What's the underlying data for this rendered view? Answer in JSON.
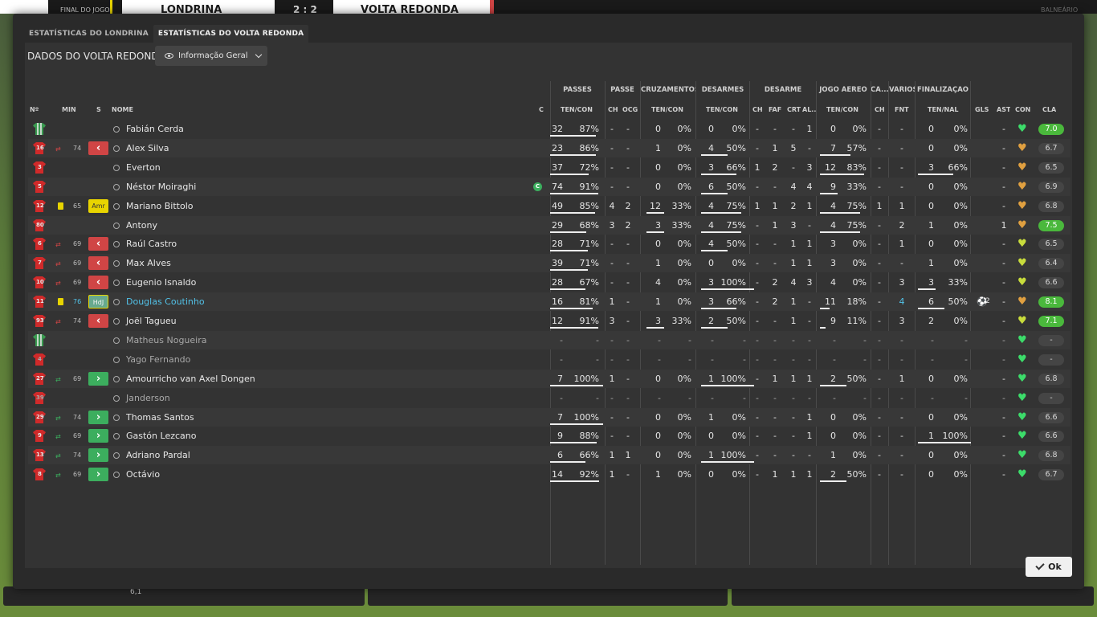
{
  "topbar": {
    "status": "FINAL DO JOGO",
    "home_team": "LONDRINA",
    "score": "2 : 2",
    "away_team": "VOLTA REDONDA",
    "right_label": "BALNEÁRIO"
  },
  "tabs": [
    {
      "label": "ESTATÍSTICAS DO LONDRINA",
      "active": false
    },
    {
      "label": "ESTATÍSTICAS DO VOLTA REDONDA",
      "active": true
    }
  ],
  "content_title": "DADOS DO VOLTA REDONDA",
  "view_dropdown": "Informação Geral",
  "column_groups": [
    "PASSES",
    "PASSE",
    "CRUZAMENTOS",
    "DESARMES",
    "DESARME",
    "JOGO AÉREO",
    "CA...",
    "VÁRIOS",
    "FINALIZAÇÃO"
  ],
  "columns": {
    "num": "Nº",
    "min": "MIN",
    "s": "S",
    "name": "NOME",
    "c": "C",
    "passes": "TEN/CON",
    "passe_ch": "CH",
    "passe_ocg": "OCG",
    "cruz": "TEN/CON",
    "des": "TEN/CON",
    "desarme_ch": "CH",
    "desarme_faf": "FAF",
    "desarme_crt": "CRT",
    "desarme_al": "AL...",
    "aereo": "TEN/CON",
    "ca_ch": "CH",
    "varios_fnt": "FNT",
    "final": "TEN/NAL",
    "gls": "GLS",
    "ast": "AST",
    "con": "CON",
    "cla": "CLA"
  },
  "players": [
    {
      "num": "",
      "shirt": "gk",
      "min": "",
      "sub": "",
      "card": false,
      "status": "",
      "name": "Fabián Cerda",
      "captain": false,
      "pass_t": "32",
      "pass_p": "87%",
      "p_ch": "-",
      "p_ocg": "-",
      "cr_t": "0",
      "cr_p": "0%",
      "de_t": "0",
      "de_p": "0%",
      "d_ch": "-",
      "d_faf": "-",
      "d_crt": "-",
      "d_al": "1",
      "a_t": "0",
      "a_p": "0%",
      "ca_ch": "-",
      "fnt": "-",
      "f_t": "0",
      "f_p": "0%",
      "gls": "",
      "ast": "-",
      "con_color": "#3cdc6a",
      "cla": "7.0",
      "cla_hi": true,
      "highlight": false
    },
    {
      "num": "16",
      "shirt": "red",
      "min": "74",
      "sub": "out",
      "card": false,
      "status": "out",
      "name": "Alex Silva",
      "captain": false,
      "pass_t": "23",
      "pass_p": "86%",
      "p_ch": "-",
      "p_ocg": "-",
      "cr_t": "1",
      "cr_p": "0%",
      "de_t": "4",
      "de_p": "50%",
      "d_ch": "-",
      "d_faf": "1",
      "d_crt": "5",
      "d_al": "-",
      "a_t": "7",
      "a_p": "57%",
      "ca_ch": "-",
      "fnt": "-",
      "f_t": "0",
      "f_p": "0%",
      "gls": "",
      "ast": "-",
      "con_color": "#e0a040",
      "cla": "6.7",
      "cla_hi": false,
      "highlight": false
    },
    {
      "num": "3",
      "shirt": "red",
      "min": "",
      "sub": "",
      "card": false,
      "status": "",
      "name": "Everton",
      "captain": false,
      "pass_t": "37",
      "pass_p": "72%",
      "p_ch": "-",
      "p_ocg": "-",
      "cr_t": "0",
      "cr_p": "0%",
      "de_t": "3",
      "de_p": "66%",
      "d_ch": "1",
      "d_faf": "2",
      "d_crt": "-",
      "d_al": "3",
      "a_t": "12",
      "a_p": "83%",
      "ca_ch": "-",
      "fnt": "-",
      "f_t": "3",
      "f_p": "66%",
      "gls": "",
      "ast": "-",
      "con_color": "#e0a040",
      "cla": "6.5",
      "cla_hi": false,
      "highlight": false
    },
    {
      "num": "5",
      "shirt": "red",
      "min": "",
      "sub": "",
      "card": false,
      "status": "",
      "name": "Néstor Moiraghi",
      "captain": true,
      "pass_t": "74",
      "pass_p": "91%",
      "p_ch": "-",
      "p_ocg": "-",
      "cr_t": "0",
      "cr_p": "0%",
      "de_t": "6",
      "de_p": "50%",
      "d_ch": "-",
      "d_faf": "-",
      "d_crt": "4",
      "d_al": "4",
      "a_t": "9",
      "a_p": "33%",
      "ca_ch": "-",
      "fnt": "-",
      "f_t": "0",
      "f_p": "0%",
      "gls": "",
      "ast": "-",
      "con_color": "#e0a040",
      "cla": "6.9",
      "cla_hi": false,
      "highlight": false
    },
    {
      "num": "12",
      "shirt": "red",
      "min": "65",
      "sub": "",
      "card": true,
      "status": "amr",
      "name": "Mariano Bittolo",
      "captain": false,
      "pass_t": "49",
      "pass_p": "85%",
      "p_ch": "4",
      "p_ocg": "2",
      "cr_t": "12",
      "cr_p": "33%",
      "de_t": "4",
      "de_p": "75%",
      "d_ch": "1",
      "d_faf": "1",
      "d_crt": "2",
      "d_al": "1",
      "a_t": "4",
      "a_p": "75%",
      "ca_ch": "1",
      "fnt": "1",
      "f_t": "0",
      "f_p": "0%",
      "gls": "",
      "ast": "-",
      "con_color": "#e0a040",
      "cla": "6.8",
      "cla_hi": false,
      "highlight": false
    },
    {
      "num": "80",
      "shirt": "red",
      "min": "",
      "sub": "",
      "card": false,
      "status": "",
      "name": "Antony",
      "captain": false,
      "pass_t": "29",
      "pass_p": "68%",
      "p_ch": "3",
      "p_ocg": "2",
      "cr_t": "3",
      "cr_p": "33%",
      "de_t": "4",
      "de_p": "75%",
      "d_ch": "-",
      "d_faf": "1",
      "d_crt": "3",
      "d_al": "-",
      "a_t": "4",
      "a_p": "75%",
      "ca_ch": "-",
      "fnt": "2",
      "f_t": "1",
      "f_p": "0%",
      "gls": "",
      "ast": "1",
      "con_color": "#e0a040",
      "cla": "7.5",
      "cla_hi": true,
      "highlight": false
    },
    {
      "num": "6",
      "shirt": "red",
      "min": "69",
      "sub": "out",
      "card": false,
      "status": "out",
      "name": "Raúl Castro",
      "captain": false,
      "pass_t": "28",
      "pass_p": "71%",
      "p_ch": "-",
      "p_ocg": "-",
      "cr_t": "0",
      "cr_p": "0%",
      "de_t": "4",
      "de_p": "50%",
      "d_ch": "-",
      "d_faf": "-",
      "d_crt": "1",
      "d_al": "1",
      "a_t": "3",
      "a_p": "0%",
      "ca_ch": "-",
      "fnt": "1",
      "f_t": "0",
      "f_p": "0%",
      "gls": "",
      "ast": "-",
      "con_color": "#c8dc3c",
      "cla": "6.5",
      "cla_hi": false,
      "highlight": false
    },
    {
      "num": "7",
      "shirt": "red",
      "min": "69",
      "sub": "out",
      "card": false,
      "status": "out",
      "name": "Max Alves",
      "captain": false,
      "pass_t": "39",
      "pass_p": "71%",
      "p_ch": "-",
      "p_ocg": "-",
      "cr_t": "1",
      "cr_p": "0%",
      "de_t": "0",
      "de_p": "0%",
      "d_ch": "-",
      "d_faf": "-",
      "d_crt": "1",
      "d_al": "1",
      "a_t": "3",
      "a_p": "0%",
      "ca_ch": "-",
      "fnt": "-",
      "f_t": "1",
      "f_p": "0%",
      "gls": "",
      "ast": "-",
      "con_color": "#c8dc3c",
      "cla": "6.4",
      "cla_hi": false,
      "highlight": false
    },
    {
      "num": "10",
      "shirt": "red",
      "min": "69",
      "sub": "out",
      "card": false,
      "status": "out",
      "name": "Eugenio Isnaldo",
      "captain": false,
      "pass_t": "28",
      "pass_p": "67%",
      "p_ch": "-",
      "p_ocg": "-",
      "cr_t": "4",
      "cr_p": "0%",
      "de_t": "3",
      "de_p": "100%",
      "d_ch": "-",
      "d_faf": "2",
      "d_crt": "4",
      "d_al": "3",
      "a_t": "4",
      "a_p": "0%",
      "ca_ch": "-",
      "fnt": "3",
      "f_t": "3",
      "f_p": "33%",
      "gls": "",
      "ast": "-",
      "con_color": "#c8dc3c",
      "cla": "6.6",
      "cla_hi": false,
      "highlight": false
    },
    {
      "num": "11",
      "shirt": "red",
      "min": "76",
      "sub": "",
      "card": true,
      "status": "hdj",
      "name": "Douglas Coutinho",
      "captain": false,
      "pass_t": "16",
      "pass_p": "81%",
      "p_ch": "1",
      "p_ocg": "-",
      "cr_t": "1",
      "cr_p": "0%",
      "de_t": "3",
      "de_p": "66%",
      "d_ch": "-",
      "d_faf": "2",
      "d_crt": "1",
      "d_al": "-",
      "a_t": "11",
      "a_p": "18%",
      "ca_ch": "-",
      "fnt": "4",
      "f_t": "6",
      "f_p": "50%",
      "gls": "2",
      "ast": "-",
      "con_color": "#e0a040",
      "cla": "8.1",
      "cla_hi": true,
      "highlight": true
    },
    {
      "num": "93",
      "shirt": "red",
      "min": "74",
      "sub": "out",
      "card": false,
      "status": "out",
      "name": "Joël Tagueu",
      "captain": false,
      "pass_t": "12",
      "pass_p": "91%",
      "p_ch": "3",
      "p_ocg": "-",
      "cr_t": "3",
      "cr_p": "33%",
      "de_t": "2",
      "de_p": "50%",
      "d_ch": "-",
      "d_faf": "-",
      "d_crt": "1",
      "d_al": "-",
      "a_t": "9",
      "a_p": "11%",
      "ca_ch": "-",
      "fnt": "3",
      "f_t": "2",
      "f_p": "0%",
      "gls": "",
      "ast": "-",
      "con_color": "#c8dc3c",
      "cla": "7.1",
      "cla_hi": true,
      "highlight": false
    },
    {
      "num": "",
      "shirt": "gk",
      "min": "",
      "sub": "",
      "card": false,
      "status": "",
      "name": "Matheus Nogueira",
      "captain": false,
      "pass_t": "-",
      "pass_p": "-",
      "p_ch": "-",
      "p_ocg": "-",
      "cr_t": "-",
      "cr_p": "-",
      "de_t": "-",
      "de_p": "-",
      "d_ch": "-",
      "d_faf": "-",
      "d_crt": "-",
      "d_al": "-",
      "a_t": "-",
      "a_p": "-",
      "ca_ch": "-",
      "fnt": "-",
      "f_t": "-",
      "f_p": "-",
      "gls": "",
      "ast": "-",
      "con_color": "#3cdc6a",
      "cla": "-",
      "cla_hi": false,
      "highlight": false,
      "dim": true
    },
    {
      "num": "4",
      "shirt": "red",
      "min": "",
      "sub": "",
      "card": false,
      "status": "",
      "name": "Yago Fernando",
      "captain": false,
      "pass_t": "-",
      "pass_p": "-",
      "p_ch": "-",
      "p_ocg": "-",
      "cr_t": "-",
      "cr_p": "-",
      "de_t": "-",
      "de_p": "-",
      "d_ch": "-",
      "d_faf": "-",
      "d_crt": "-",
      "d_al": "-",
      "a_t": "-",
      "a_p": "-",
      "ca_ch": "-",
      "fnt": "-",
      "f_t": "-",
      "f_p": "-",
      "gls": "",
      "ast": "-",
      "con_color": "#3cdc6a",
      "cla": "-",
      "cla_hi": false,
      "highlight": false,
      "dim": true
    },
    {
      "num": "27",
      "shirt": "red",
      "min": "69",
      "sub": "in",
      "card": false,
      "status": "in",
      "name": "Amourricho van Axel Dongen",
      "captain": false,
      "pass_t": "7",
      "pass_p": "100%",
      "p_ch": "1",
      "p_ocg": "-",
      "cr_t": "0",
      "cr_p": "0%",
      "de_t": "1",
      "de_p": "100%",
      "d_ch": "-",
      "d_faf": "1",
      "d_crt": "1",
      "d_al": "1",
      "a_t": "2",
      "a_p": "50%",
      "ca_ch": "-",
      "fnt": "1",
      "f_t": "0",
      "f_p": "0%",
      "gls": "",
      "ast": "-",
      "con_color": "#3cdc6a",
      "cla": "6.8",
      "cla_hi": false,
      "highlight": false
    },
    {
      "num": "39",
      "shirt": "red",
      "min": "",
      "sub": "",
      "card": false,
      "status": "",
      "name": "Janderson",
      "captain": false,
      "pass_t": "-",
      "pass_p": "-",
      "p_ch": "-",
      "p_ocg": "-",
      "cr_t": "-",
      "cr_p": "-",
      "de_t": "-",
      "de_p": "-",
      "d_ch": "-",
      "d_faf": "-",
      "d_crt": "-",
      "d_al": "-",
      "a_t": "-",
      "a_p": "-",
      "ca_ch": "-",
      "fnt": "-",
      "f_t": "-",
      "f_p": "-",
      "gls": "",
      "ast": "-",
      "con_color": "#3cdc6a",
      "cla": "-",
      "cla_hi": false,
      "highlight": false,
      "dim": true
    },
    {
      "num": "29",
      "shirt": "red",
      "min": "74",
      "sub": "in",
      "card": false,
      "status": "in",
      "name": "Thomas Santos",
      "captain": false,
      "pass_t": "7",
      "pass_p": "100%",
      "p_ch": "-",
      "p_ocg": "-",
      "cr_t": "0",
      "cr_p": "0%",
      "de_t": "1",
      "de_p": "0%",
      "d_ch": "-",
      "d_faf": "-",
      "d_crt": "-",
      "d_al": "1",
      "a_t": "0",
      "a_p": "0%",
      "ca_ch": "-",
      "fnt": "-",
      "f_t": "0",
      "f_p": "0%",
      "gls": "",
      "ast": "-",
      "con_color": "#3cdc6a",
      "cla": "6.6",
      "cla_hi": false,
      "highlight": false
    },
    {
      "num": "9",
      "shirt": "red",
      "min": "69",
      "sub": "in",
      "card": false,
      "status": "in",
      "name": "Gastón Lezcano",
      "captain": false,
      "pass_t": "9",
      "pass_p": "88%",
      "p_ch": "-",
      "p_ocg": "-",
      "cr_t": "0",
      "cr_p": "0%",
      "de_t": "0",
      "de_p": "0%",
      "d_ch": "-",
      "d_faf": "-",
      "d_crt": "-",
      "d_al": "1",
      "a_t": "0",
      "a_p": "0%",
      "ca_ch": "-",
      "fnt": "-",
      "f_t": "1",
      "f_p": "100%",
      "gls": "",
      "ast": "-",
      "con_color": "#3cdc6a",
      "cla": "6.6",
      "cla_hi": false,
      "highlight": false
    },
    {
      "num": "13",
      "shirt": "red",
      "min": "74",
      "sub": "in",
      "card": false,
      "status": "in",
      "name": "Adriano Pardal",
      "captain": false,
      "pass_t": "6",
      "pass_p": "66%",
      "p_ch": "1",
      "p_ocg": "1",
      "cr_t": "0",
      "cr_p": "0%",
      "de_t": "1",
      "de_p": "100%",
      "d_ch": "-",
      "d_faf": "-",
      "d_crt": "-",
      "d_al": "-",
      "a_t": "1",
      "a_p": "0%",
      "ca_ch": "-",
      "fnt": "-",
      "f_t": "0",
      "f_p": "0%",
      "gls": "",
      "ast": "-",
      "con_color": "#3cdc6a",
      "cla": "6.8",
      "cla_hi": false,
      "highlight": false
    },
    {
      "num": "8",
      "shirt": "red",
      "min": "69",
      "sub": "in",
      "card": false,
      "status": "in",
      "name": "Octávio",
      "captain": false,
      "pass_t": "14",
      "pass_p": "92%",
      "p_ch": "1",
      "p_ocg": "-",
      "cr_t": "1",
      "cr_p": "0%",
      "de_t": "0",
      "de_p": "0%",
      "d_ch": "-",
      "d_faf": "1",
      "d_crt": "1",
      "d_al": "1",
      "a_t": "2",
      "a_p": "50%",
      "ca_ch": "-",
      "fnt": "-",
      "f_t": "0",
      "f_p": "0%",
      "gls": "",
      "ast": "-",
      "con_color": "#3cdc6a",
      "cla": "6.7",
      "cla_hi": false,
      "highlight": false
    }
  ],
  "status_labels": {
    "amr": "Amr",
    "hdj": "HdJ",
    "captain": "C"
  },
  "bottom_value": "6,1",
  "ok_label": "Ok",
  "colors": {
    "out": "#d04545",
    "in": "#3cae5e",
    "card": "#e8d400",
    "rating_hi": "#4ab83c",
    "link": "#52c2e8"
  }
}
